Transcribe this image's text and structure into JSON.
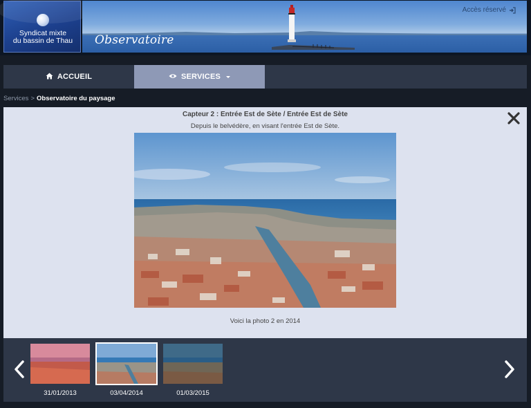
{
  "header": {
    "logo_text_line1": "Syndicat mixte",
    "logo_text_line2": "du bassin de Thau",
    "brand_title": "Observatoire",
    "access_link": "Accès réservé",
    "access_icon": "login-icon"
  },
  "nav": {
    "items": [
      {
        "label": "ACCUEIL",
        "icon": "home-icon"
      },
      {
        "label": "SERVICES",
        "icon": "eye-icon",
        "has_dropdown": true,
        "active": true
      }
    ]
  },
  "breadcrumb": {
    "parent": "Services",
    "separator": ">",
    "current": "Observatoire du paysage"
  },
  "viewer": {
    "title": "Capteur 2 : Entrée Est de Sète / Entrée Est de Sète",
    "subtitle": "Depuis le belvédère, en visant l'entrée Est de Sète.",
    "photo_caption": "Voici la photo 2 en 2014",
    "close_icon": "close-icon"
  },
  "thumbnails": [
    {
      "date": "31/01/2013",
      "selected": false
    },
    {
      "date": "03/04/2014",
      "selected": true
    },
    {
      "date": "01/03/2015",
      "selected": false
    }
  ],
  "colors": {
    "page_bg": "#161c26",
    "nav_bg": "#2e3748",
    "nav_active": "#8e99b6",
    "panel_bg": "#dde2ef"
  }
}
